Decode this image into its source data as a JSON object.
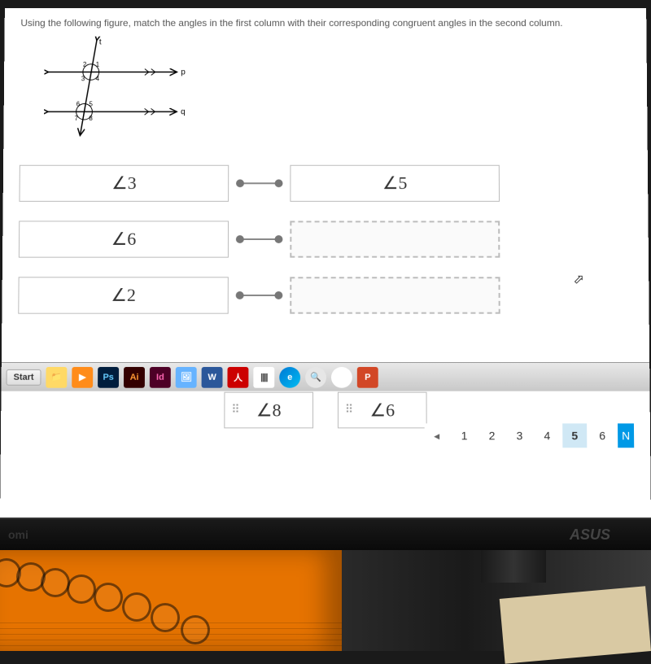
{
  "question": "Using the following figure, match the angles in the first column with their corresponding congruent angles in the second column.",
  "figure": {
    "line_labels": {
      "top": "t",
      "line1": "p",
      "line2": "q"
    },
    "angles": [
      "1",
      "2",
      "3",
      "4",
      "5",
      "6",
      "7",
      "8"
    ]
  },
  "matching": {
    "left": [
      "∠3",
      "∠6",
      "∠2"
    ],
    "right": [
      "∠5",
      "",
      ""
    ]
  },
  "choices": [
    "∠8",
    "∠6"
  ],
  "pagination": {
    "prev": "◂",
    "pages": [
      "1",
      "2",
      "3",
      "4",
      "5",
      "6"
    ],
    "active": "5",
    "next_label": "N"
  },
  "taskbar": {
    "start": "Start",
    "icons": {
      "folder": "📁",
      "play": "▶",
      "ps": "Ps",
      "ai": "Ai",
      "id": "Id",
      "img": "🖼",
      "word": "W",
      "pdf": "人",
      "bars": "||||",
      "edge": "e",
      "mag": "🔍",
      "chrome": "◉",
      "ppt": "P"
    }
  },
  "monitor": {
    "brand": "ASUS",
    "port": "omi"
  }
}
